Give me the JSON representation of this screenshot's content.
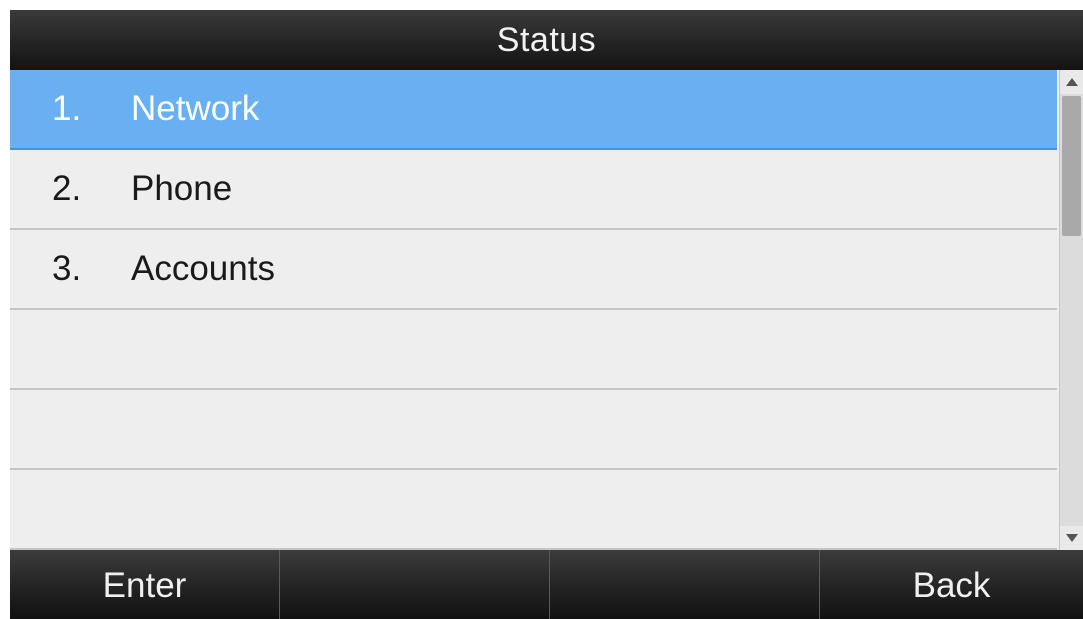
{
  "header": {
    "title": "Status"
  },
  "menu": {
    "items": [
      {
        "number": "1.",
        "label": "Network",
        "selected": true
      },
      {
        "number": "2.",
        "label": "Phone",
        "selected": false
      },
      {
        "number": "3.",
        "label": "Accounts",
        "selected": false
      },
      {
        "number": "",
        "label": "",
        "selected": false
      },
      {
        "number": "",
        "label": "",
        "selected": false
      },
      {
        "number": "",
        "label": "",
        "selected": false
      }
    ]
  },
  "softkeys": {
    "key1": "Enter",
    "key2": "",
    "key3": "",
    "key4": "Back"
  },
  "colors": {
    "highlight": "#69b0f2",
    "list_background": "#eeeeee",
    "bar_background": "#1c1c1c"
  },
  "icons": {
    "scroll_up": "triangle-up-icon",
    "scroll_down": "triangle-down-icon"
  }
}
